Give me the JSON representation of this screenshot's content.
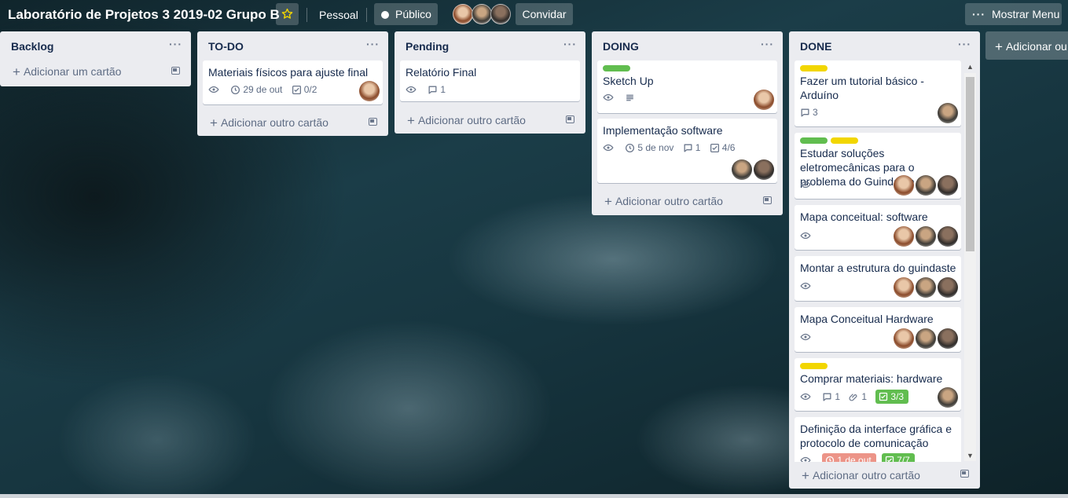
{
  "header": {
    "board_title": "Laboratório de Projetos 3 2019-02 Grupo B",
    "team_label": "Pessoal",
    "visibility_label": "Público",
    "invite_label": "Convidar",
    "menu_label": "Mostrar Menu",
    "members": [
      "member-1",
      "member-2",
      "member-3"
    ]
  },
  "add_list_label": "Adicionar outra lista",
  "add_list_visible": "Adicionar ou",
  "icons": {
    "star": "star-icon",
    "globe": "globe-icon",
    "eye": "eye-icon",
    "clock": "clock-icon",
    "comment": "comment-icon",
    "checklist": "checklist-icon",
    "description": "description-icon",
    "attachment": "paperclip-icon",
    "template": "card-template-icon"
  },
  "colors": {
    "label_green": "#61bd4f",
    "label_yellow": "#f2d600",
    "due_overdue": "#ec9488",
    "checklist_complete": "#61bd4f"
  },
  "lists": [
    {
      "title": "Backlog",
      "add_label": "Adicionar um cartão",
      "cards": []
    },
    {
      "title": "TO-DO",
      "add_label": "Adicionar outro cartão",
      "cards": [
        {
          "title": "Materiais físicos para ajuste final",
          "due": "29 de out",
          "checklist": "0/2",
          "members": 1
        }
      ]
    },
    {
      "title": "Pending",
      "add_label": "Adicionar outro cartão",
      "cards": [
        {
          "title": "Relatório Final",
          "comments": "1"
        }
      ]
    },
    {
      "title": "DOING",
      "add_label": "Adicionar outro cartão",
      "cards": [
        {
          "title": "Sketch Up",
          "labels": [
            "green"
          ]
        },
        {
          "title": "Implementação software",
          "due": "5 de nov",
          "comments": "1",
          "checklist": "4/6"
        }
      ]
    },
    {
      "title": "DONE",
      "add_label": "Adicionar outro cartão",
      "cards": [
        {
          "title": "Fazer um tutorial básico - Arduíno",
          "labels": [
            "yellow"
          ],
          "comments": "3"
        },
        {
          "title": "Estudar soluções eletromecânicas para o problema do Guindaste",
          "labels": [
            "green",
            "yellow"
          ]
        },
        {
          "title": "Mapa conceitual: software"
        },
        {
          "title": "Montar a estrutura do guindaste"
        },
        {
          "title": "Mapa Conceitual Hardware"
        },
        {
          "title": "Comprar materiais: hardware",
          "labels": [
            "yellow"
          ],
          "comments": "1",
          "attachments": "1",
          "checklist": "3/3"
        },
        {
          "title": "Definição da interface gráfica e protocolo de comunicação",
          "due": "1 de out",
          "checklist": "7/7"
        }
      ]
    }
  ]
}
